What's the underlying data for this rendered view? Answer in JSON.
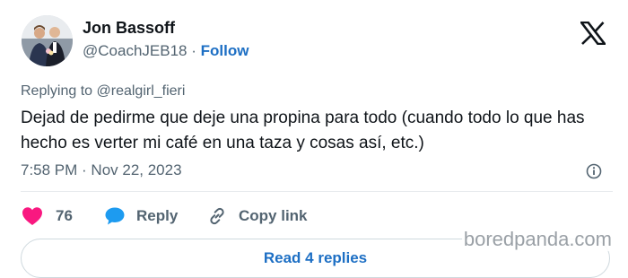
{
  "author": {
    "display_name": "Jon Bassoff",
    "handle": "@CoachJEB18",
    "separator": "·",
    "follow_label": "Follow"
  },
  "reply_context": "Replying to @realgirl_fieri",
  "tweet": {
    "text": "Dejad de pedirme que deje una propina para todo (cuando todo lo que has hecho es verter mi café en una taza y cosas así, etc.)",
    "timestamp": "7:58 PM · Nov 22, 2023"
  },
  "actions": {
    "likes_count": "76",
    "reply_label": "Reply",
    "copy_link_label": "Copy link"
  },
  "read_replies_label": "Read 4 replies",
  "watermark": "boredpanda.com",
  "icons": {
    "brand": "x-logo-icon",
    "info": "info-icon",
    "like": "heart-icon",
    "reply": "speech-bubble-icon",
    "copy_link": "link-icon"
  },
  "colors": {
    "like": "#f91880",
    "reply_icon": "#1d9bf0",
    "follow": "#1d6fc4",
    "secondary_text": "#536471"
  }
}
